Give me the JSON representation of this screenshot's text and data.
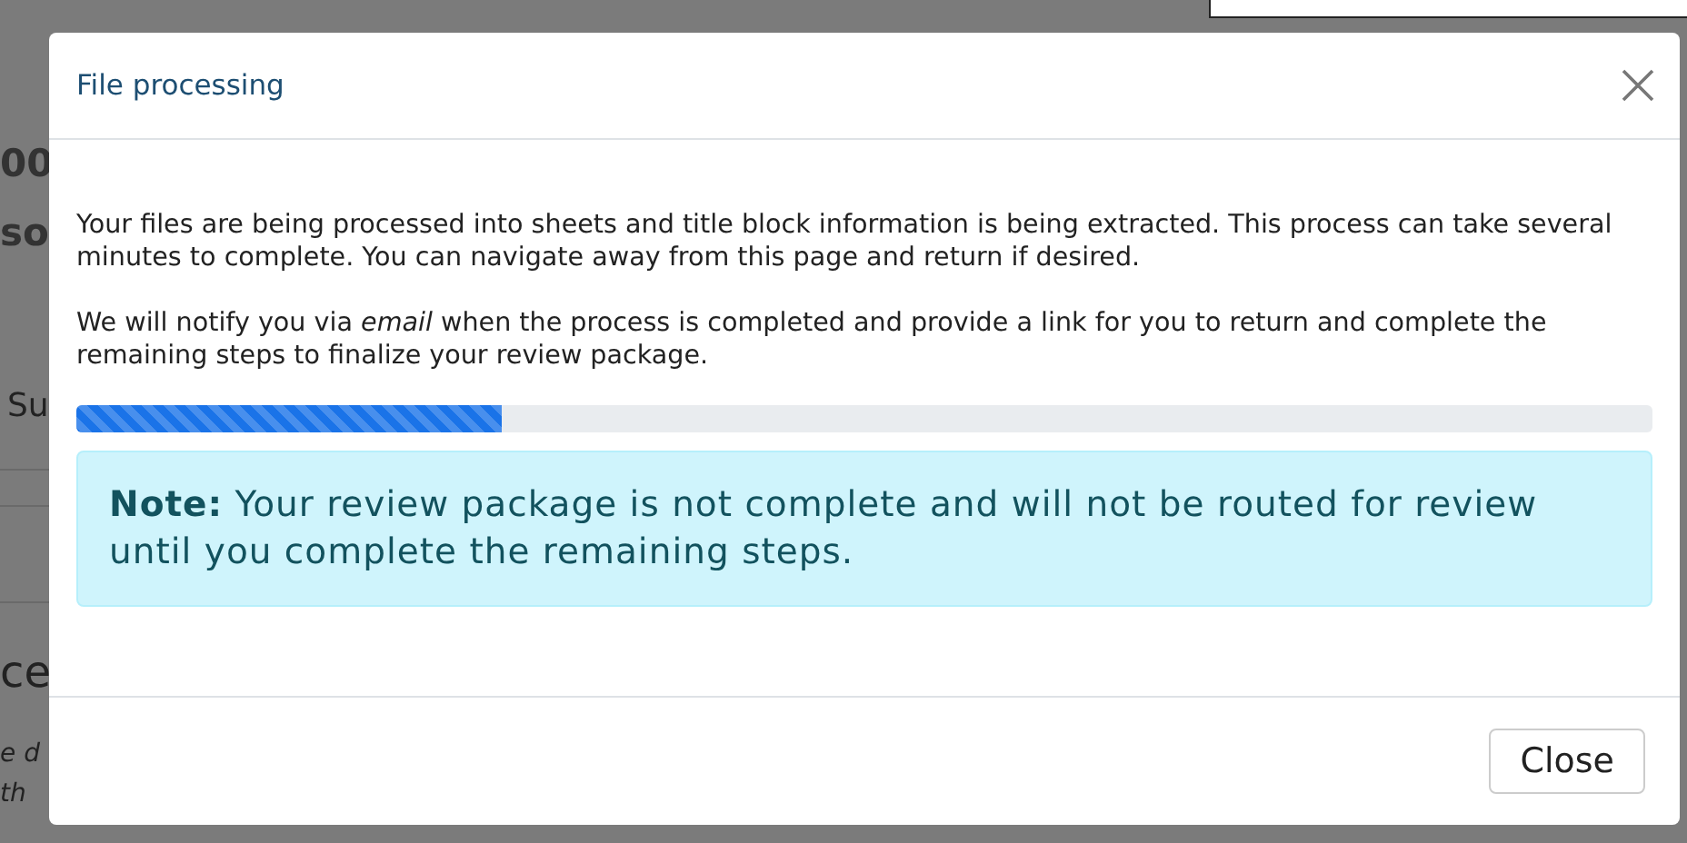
{
  "background_fragments": [
    {
      "text": "00",
      "kind": "heading"
    },
    {
      "text": "so",
      "kind": "heading"
    },
    {
      "text": "Su",
      "kind": "label"
    },
    {
      "text": "ce",
      "kind": "title"
    },
    {
      "text": "e d",
      "kind": "italic"
    },
    {
      "text": "th",
      "kind": "italic"
    }
  ],
  "dialog": {
    "title": "File processing",
    "paragraphs": [
      "Your files are being processed into sheets and title block information is being extracted. This process can take several minutes to complete. You can navigate away from this page and return if desired.",
      "We will notify you via *email* when the process is completed and provide a link for you to return and complete the remaining steps to finalize your review package."
    ],
    "progress": {
      "level": 0.27
    },
    "note": "**Note:** Your review package is not complete and will not be routed for review until you complete the remaining steps.",
    "buttons": [
      "Close"
    ]
  }
}
